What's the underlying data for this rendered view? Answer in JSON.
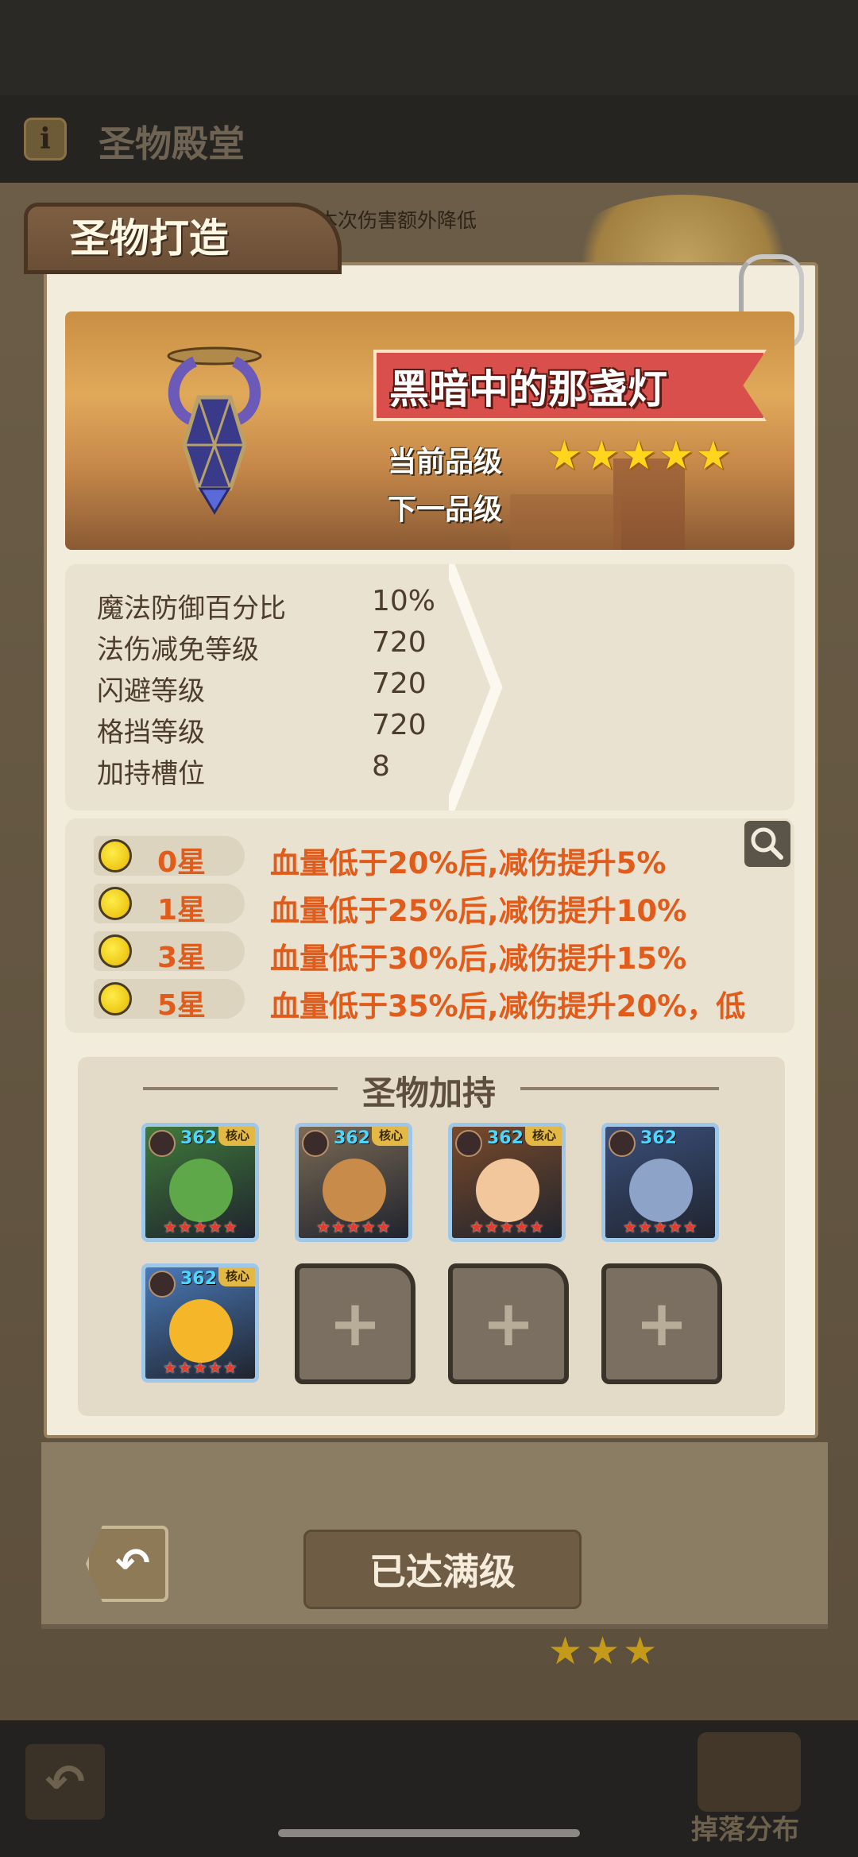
{
  "header": {
    "info_icon_glyph": "i",
    "title": "圣物殿堂"
  },
  "background": {
    "partial_text": "本次伤害额外降低"
  },
  "panel": {
    "tab_title": "圣物打造",
    "relic": {
      "name": "黑暗中的那盏灯",
      "current_grade_label": "当前品级",
      "next_grade_label": "下一品级",
      "current_stars": 5
    },
    "stats": [
      {
        "name": "魔法防御百分比",
        "value": "10%"
      },
      {
        "name": "法伤减免等级",
        "value": "720"
      },
      {
        "name": "闪避等级",
        "value": "720"
      },
      {
        "name": "格挡等级",
        "value": "720"
      },
      {
        "name": "加持槽位",
        "value": "8"
      }
    ],
    "effects": [
      {
        "star": "0星",
        "desc": "血量低于20%后,减伤提升5%"
      },
      {
        "star": "1星",
        "desc": "血量低于25%后,减伤提升10%"
      },
      {
        "star": "3星",
        "desc": "血量低于30%后,减伤提升15%"
      },
      {
        "star": "5星",
        "desc": "血量低于35%后,减伤提升20%，低"
      }
    ],
    "support": {
      "title": "圣物加持",
      "heroes": [
        {
          "level": "362",
          "core": "核心",
          "stars": "★★★★★",
          "color": "#3f7a3a",
          "skin": "#5fa84a"
        },
        {
          "level": "362",
          "core": "核心",
          "stars": "★★★★★",
          "color": "#7b6a55",
          "skin": "#c98b4a"
        },
        {
          "level": "362",
          "core": "核心",
          "stars": "★★★★★",
          "color": "#7a4a2a",
          "skin": "#f2c79b"
        },
        {
          "level": "362",
          "core": "",
          "stars": "★★★★★",
          "color": "#3a4f7a",
          "skin": "#8ea3c8"
        },
        {
          "level": "362",
          "core": "核心",
          "stars": "★★★★★",
          "color": "#4a7ab8",
          "skin": "#f5b62a"
        }
      ],
      "empty_slot_glyph": "+"
    }
  },
  "buttons": {
    "back_glyph": "↶",
    "max_level": "已达满级"
  },
  "footer": {
    "back_glyph": "↶",
    "drop_label": "掉落分布"
  }
}
